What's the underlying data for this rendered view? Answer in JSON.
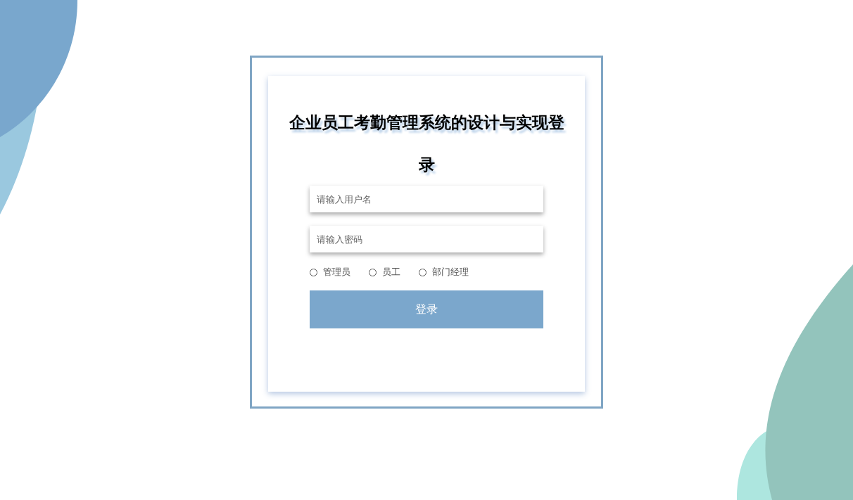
{
  "title": "企业员工考勤管理系统的设计与实现登录",
  "fields": [
    {
      "placeholder": "请输入用户名"
    },
    {
      "placeholder": "请输入密码"
    }
  ],
  "roles": [
    {
      "label": "管理员",
      "selected": false
    },
    {
      "label": "员工",
      "selected": false
    },
    {
      "label": "部门经理",
      "selected": false
    }
  ],
  "submit": "登录"
}
